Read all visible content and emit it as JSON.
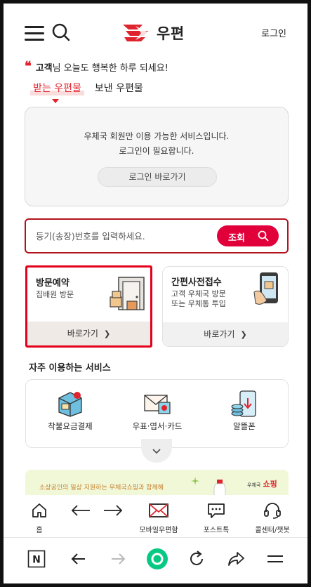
{
  "header": {
    "logo_text": "우편",
    "login_label": "로그인"
  },
  "greeting": {
    "quote": "❝",
    "name": "고객",
    "message": "님 오늘도 행복한 하루 되세요!"
  },
  "tabs": [
    {
      "label": "받는 우편물",
      "active": true
    },
    {
      "label": "보낸 우편물",
      "active": false
    }
  ],
  "login_box": {
    "line1": "우체국 회원만 이용 가능한 서비스입니다.",
    "line2": "로그인이 필요합니다.",
    "button": "로그인 바로가기"
  },
  "tracking": {
    "placeholder": "등기(송장)번호를 입력하세요.",
    "value": "",
    "button": "조회"
  },
  "cards": [
    {
      "title": "방문예약",
      "subtitle": "집배원 방문",
      "action": "바로가기"
    },
    {
      "title": "간편사전접수",
      "subtitle_line1": "고객 우체국 방문",
      "subtitle_line2": "또는 우체통 투입",
      "action": "바로가기"
    }
  ],
  "frequent": {
    "title": "자주 이용하는 서비스",
    "items": [
      {
        "label": "착불요금결제",
        "icon": "package-payment-icon"
      },
      {
        "label": "우표·엽서·카드",
        "icon": "stamp-envelope-icon"
      },
      {
        "label": "알뜰폰",
        "icon": "phone-coins-icon"
      }
    ]
  },
  "banner": {
    "text": "소상공인의 일상 지원하는 우체국쇼핑과 함께해",
    "brand_small": "우체국",
    "brand": "쇼핑"
  },
  "app_nav": [
    {
      "label": "홈",
      "icon": "home-icon"
    },
    {
      "label": "",
      "icon": "arrow-left-icon"
    },
    {
      "label": "",
      "icon": "arrow-right-icon"
    },
    {
      "label": "모바일우편함",
      "icon": "mail-envelope-icon"
    },
    {
      "label": "포스트톡",
      "icon": "chat-bubble-icon"
    },
    {
      "label": "콜센터/챗봇",
      "icon": "headset-icon"
    }
  ],
  "browser_bar": {
    "n_label": "N"
  },
  "colors": {
    "accent": "#e0242e",
    "search_button": "#e2003b",
    "highlight_border": "#e3001b"
  }
}
